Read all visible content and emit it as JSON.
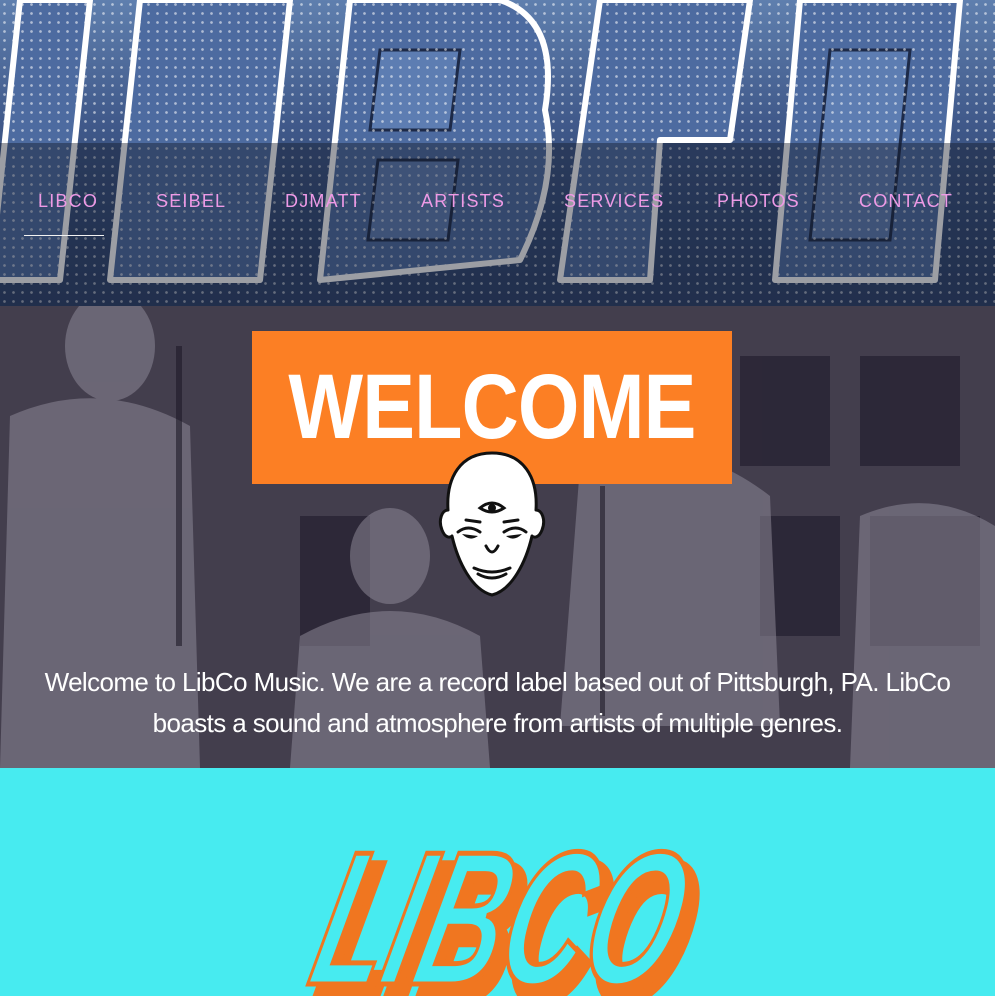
{
  "header": {
    "logo_text": "LIBCO"
  },
  "nav": {
    "items": [
      {
        "label": "LIBCO",
        "active": true
      },
      {
        "label": "SEIBEL",
        "active": false
      },
      {
        "label": "DJMATT",
        "active": false
      },
      {
        "label": "ARTISTS",
        "active": false
      },
      {
        "label": "SERVICES",
        "active": false
      },
      {
        "label": "PHOTOS",
        "active": false
      },
      {
        "label": "CONTACT",
        "active": false
      }
    ]
  },
  "welcome": {
    "title": "WELCOME",
    "body": "Welcome to LibCo Music. We are a record label based out of Pittsburgh, PA. LibCo boasts a sound and atmosphere from artists of multiple genres.",
    "icon": "third-eye-face-icon"
  },
  "brand": {
    "logo_text": "LIBCO"
  },
  "colors": {
    "nav_text": "#ee9ae6",
    "banner_orange": "#fc7f24",
    "brand_cyan": "#47ebf0",
    "header_blue": "#40598a"
  }
}
